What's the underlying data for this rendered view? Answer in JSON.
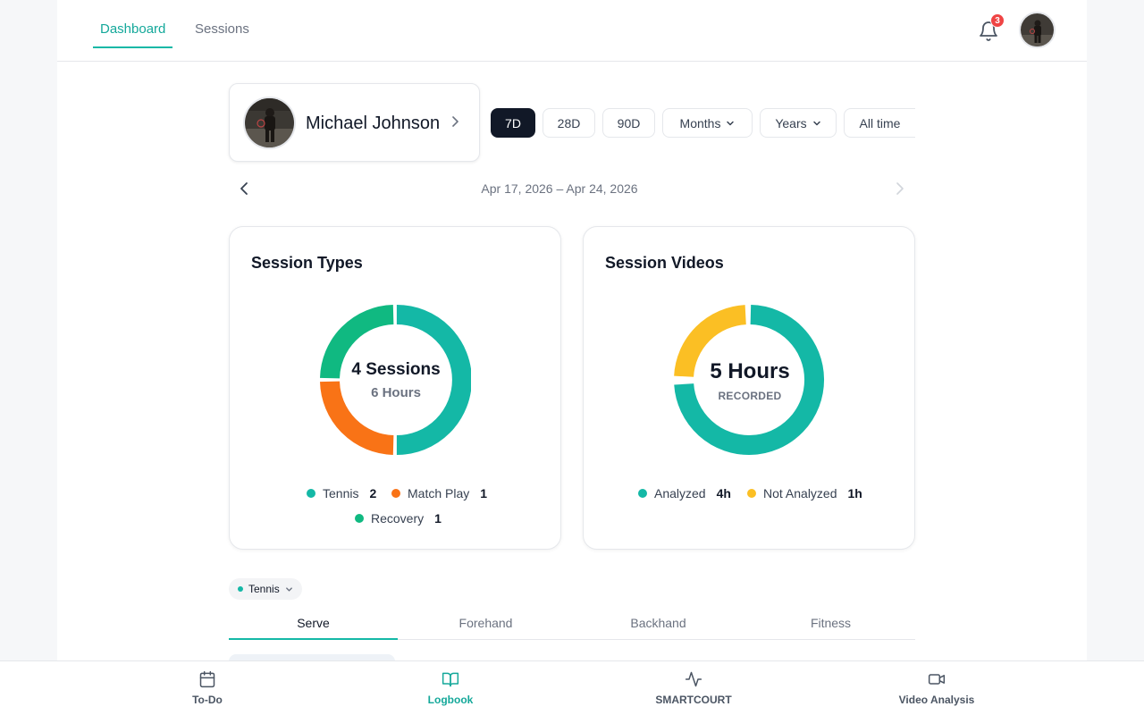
{
  "header": {
    "tabs": [
      {
        "label": "Dashboard",
        "active": true
      },
      {
        "label": "Sessions",
        "active": false
      }
    ],
    "notifications_count": "3",
    "icons": [
      "bell-icon",
      "avatar"
    ]
  },
  "profile": {
    "name": "Michael Johnson"
  },
  "range_buttons": [
    {
      "label": "7D",
      "active": true
    },
    {
      "label": "28D",
      "active": false
    },
    {
      "label": "90D",
      "active": false
    },
    {
      "label": "Months",
      "active": false,
      "dropdown": true
    },
    {
      "label": "Years",
      "active": false,
      "dropdown": true
    },
    {
      "label": "All time",
      "active": false
    }
  ],
  "date_range": "Apr 17, 2026 – Apr 24, 2026",
  "colors": {
    "accent": "#14b8a6",
    "tennis": "#14b8a6",
    "match_play": "#f97316",
    "recovery": "#10b981",
    "not_analyzed": "#fbbf24",
    "dark": "#111827"
  },
  "session_types": {
    "title": "Session Types",
    "center_main": "4 Sessions",
    "center_sub": "6 Hours",
    "legend": [
      {
        "label": "Tennis",
        "value": "2"
      },
      {
        "label": "Match Play",
        "value": "1"
      },
      {
        "label": "Recovery",
        "value": "1"
      }
    ]
  },
  "session_videos": {
    "title": "Session Videos",
    "center_main": "5 Hours",
    "center_sub": "RECORDED",
    "legend": [
      {
        "label": "Analyzed",
        "value": "4h"
      },
      {
        "label": "Not Analyzed",
        "value": "1h"
      }
    ]
  },
  "filter_chip": {
    "label": "Tennis"
  },
  "sub_tabs": [
    {
      "label": "Serve",
      "active": true
    },
    {
      "label": "Forehand",
      "active": false
    },
    {
      "label": "Backhand",
      "active": false
    },
    {
      "label": "Fitness",
      "active": false
    }
  ],
  "bottom_nav": [
    {
      "label": "To-Do",
      "icon": "calendar-icon",
      "active": false
    },
    {
      "label": "Logbook",
      "icon": "book-icon",
      "active": true
    },
    {
      "label": "SMARTCOURT",
      "icon": "activity-icon",
      "active": false
    },
    {
      "label": "Video Analysis",
      "icon": "video-icon",
      "active": false
    }
  ]
}
